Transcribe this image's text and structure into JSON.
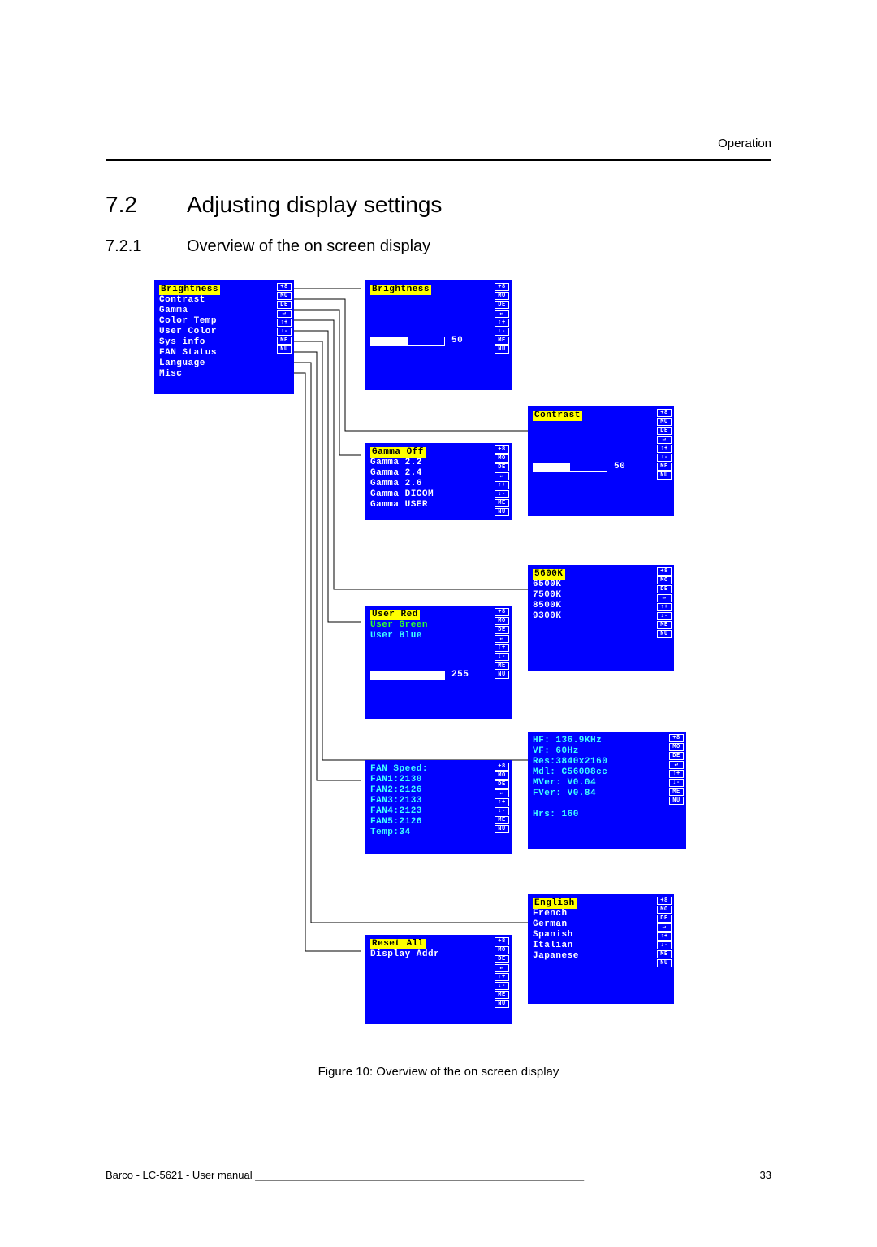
{
  "header": {
    "section_label": "Operation"
  },
  "section": {
    "num": "7.2",
    "title": "Adjusting display settings"
  },
  "subsection": {
    "num": "7.2.1",
    "title": "Overview of the on screen display"
  },
  "figure_caption": "Figure 10: Overview of the on screen display",
  "footer": {
    "left": "Barco - LC-5621 - User manual",
    "fill": "________________________________________________________",
    "page": "33"
  },
  "side_icons": [
    "+8",
    "MO",
    "DE",
    "↵",
    "↑+",
    "↓-",
    "ME",
    "NU"
  ],
  "main_menu": {
    "items": [
      "Brightness",
      "Contrast",
      "Gamma",
      "Color Temp",
      "User Color",
      "Sys info",
      "FAN Status",
      "Language",
      "Misc"
    ],
    "selected_index": 0
  },
  "brightness_panel": {
    "title": "Brightness",
    "value": "50",
    "fill_pct": 50
  },
  "contrast_panel": {
    "title": "Contrast",
    "value": "50",
    "fill_pct": 50
  },
  "gamma_menu": {
    "items": [
      "Gamma Off",
      "Gamma 2.2",
      "Gamma 2.4",
      "Gamma 2.6",
      "Gamma DICOM",
      "Gamma USER"
    ],
    "selected_index": 0
  },
  "color_temp_menu": {
    "items": [
      "5600K",
      "6500K",
      "7500K",
      "8500K",
      "9300K"
    ],
    "selected_index": 0
  },
  "user_color_menu": {
    "items": [
      "User Red",
      "User Green",
      "User Blue"
    ],
    "selected_index": 0,
    "value": "255",
    "fill_pct": 100
  },
  "fan_panel": {
    "lines": [
      "FAN Speed:",
      "FAN1:2130",
      "FAN2:2126",
      "FAN3:2133",
      "FAN4:2123",
      "FAN5:2126",
      "Temp:34"
    ]
  },
  "sysinfo_panel": {
    "lines": [
      "HF: 136.9KHz",
      "VF: 60Hz",
      "Res:3840x2160",
      "Mdl: C56008cc",
      "MVer: V0.04",
      "FVer: V0.84",
      "",
      "Hrs: 160"
    ]
  },
  "language_menu": {
    "items": [
      "English",
      "French",
      "German",
      "Spanish",
      "Italian",
      "Japanese"
    ],
    "selected_index": 0
  },
  "misc_menu": {
    "items": [
      "Reset All",
      "Display Addr"
    ],
    "selected_index": 0
  }
}
